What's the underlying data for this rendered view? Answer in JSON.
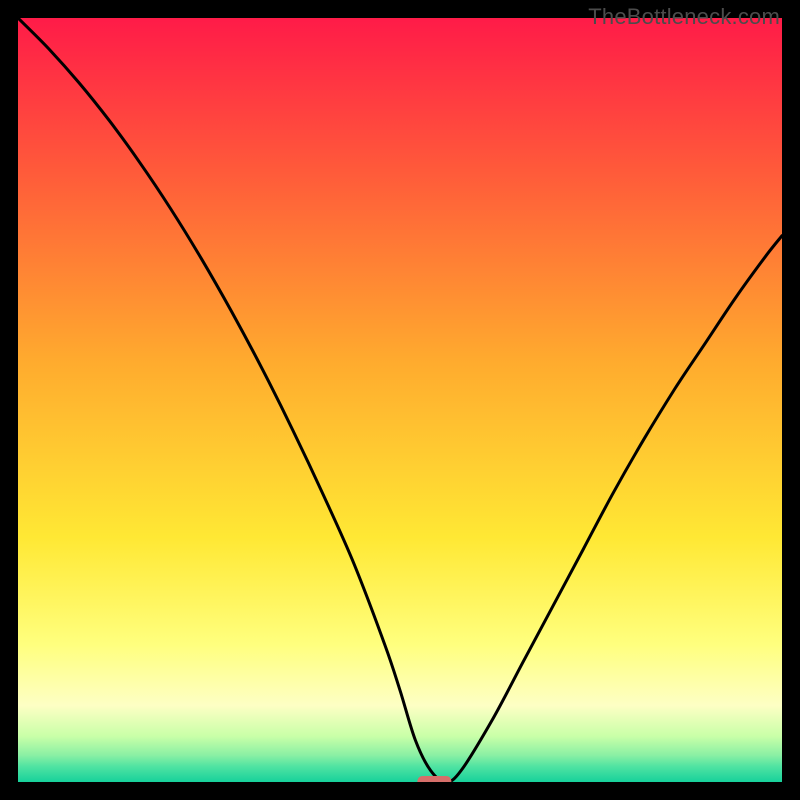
{
  "watermark": "TheBottleneck.com",
  "colors": {
    "frame": "#000000",
    "curve": "#000000",
    "marker_fill": "#d66f6a",
    "gradient_stops": [
      {
        "offset": 0.0,
        "color": "#ff1b48"
      },
      {
        "offset": 0.2,
        "color": "#ff5a3a"
      },
      {
        "offset": 0.45,
        "color": "#ffab2e"
      },
      {
        "offset": 0.68,
        "color": "#ffe834"
      },
      {
        "offset": 0.82,
        "color": "#ffff7e"
      },
      {
        "offset": 0.9,
        "color": "#fdffc4"
      },
      {
        "offset": 0.94,
        "color": "#c9ffa8"
      },
      {
        "offset": 0.965,
        "color": "#8af0a4"
      },
      {
        "offset": 0.98,
        "color": "#4fe3a2"
      },
      {
        "offset": 1.0,
        "color": "#17d19b"
      }
    ]
  },
  "chart_data": {
    "type": "line",
    "title": "",
    "xlabel": "",
    "ylabel": "",
    "xlim": [
      0,
      100
    ],
    "ylim": [
      0,
      100
    ],
    "x": [
      0,
      4,
      8,
      12,
      16,
      20,
      24,
      28,
      32,
      36,
      40,
      44,
      48,
      50,
      52,
      54,
      56,
      58,
      62,
      66,
      70,
      74,
      78,
      82,
      86,
      90,
      94,
      98,
      100
    ],
    "values": [
      100,
      96,
      91.5,
      86.5,
      81,
      75,
      68.5,
      61.5,
      54,
      46,
      37.5,
      28.5,
      18,
      12,
      5.5,
      1.5,
      0,
      1.5,
      8,
      15.5,
      23,
      30.5,
      38,
      45,
      51.5,
      57.5,
      63.5,
      69,
      71.5
    ],
    "marker": {
      "x": 54.5,
      "y": 0
    }
  }
}
